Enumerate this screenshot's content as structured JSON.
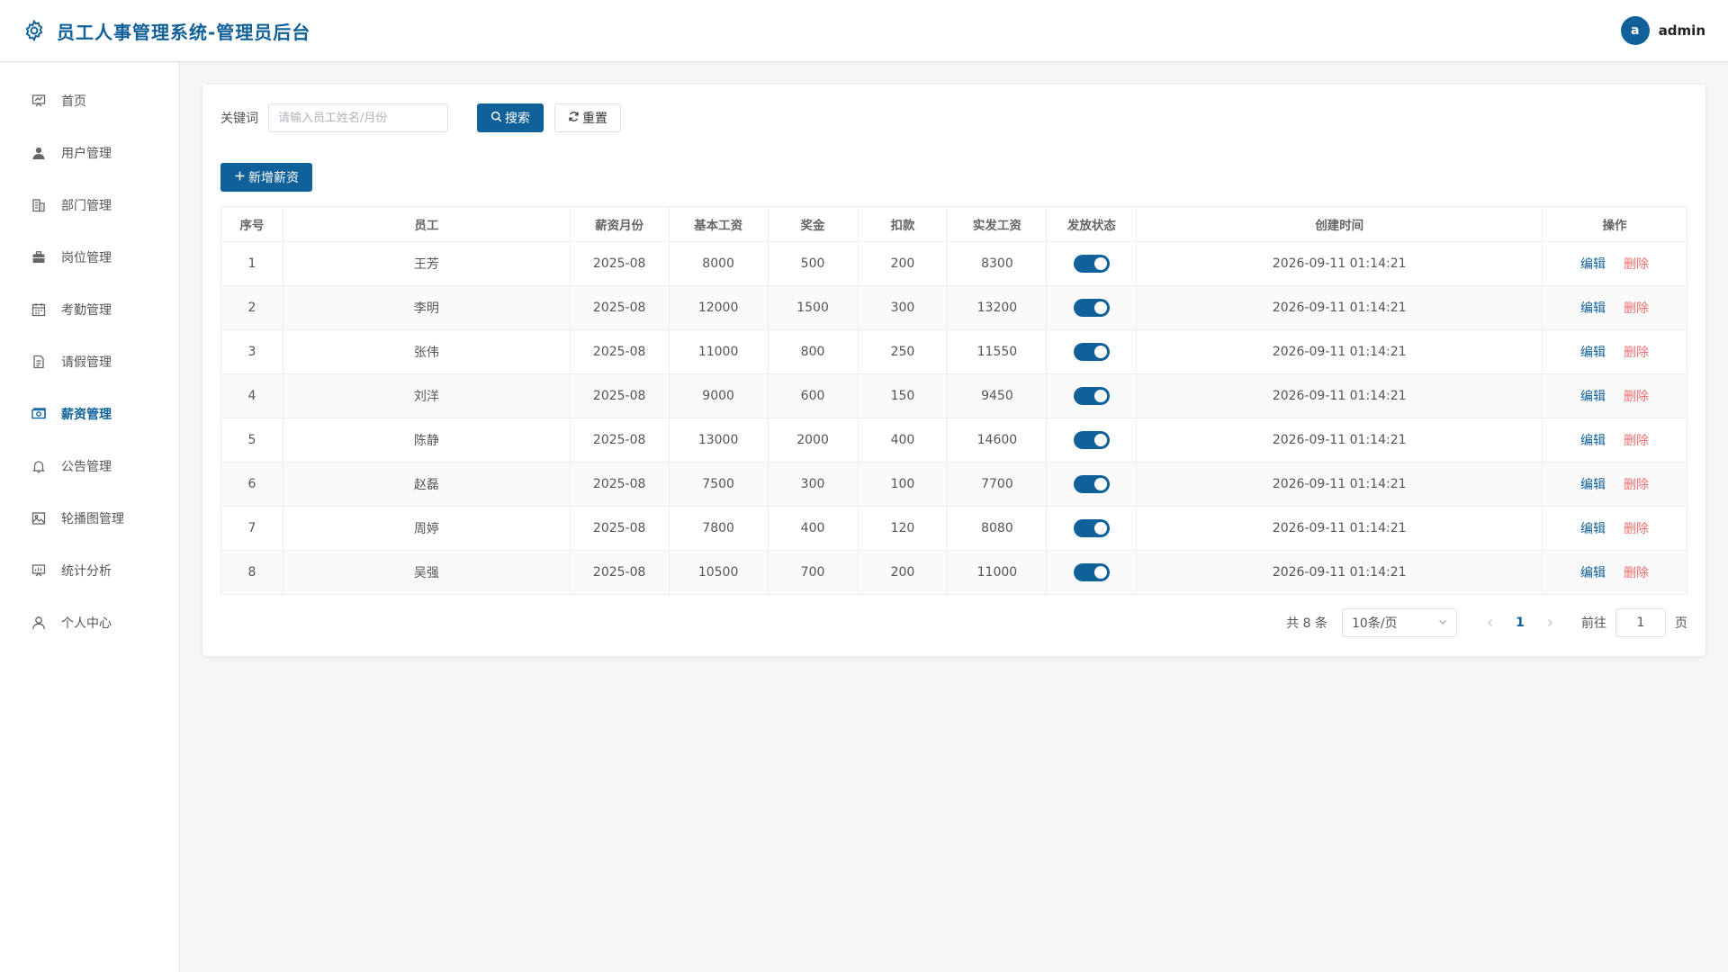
{
  "header": {
    "title": "员工人事管理系统-管理员后台",
    "avatar_letter": "a",
    "username": "admin"
  },
  "sidebar": {
    "items": [
      {
        "label": "首页",
        "icon": "presentation-board-icon"
      },
      {
        "label": "用户管理",
        "icon": "user-filled-icon"
      },
      {
        "label": "部门管理",
        "icon": "office-building-icon"
      },
      {
        "label": "岗位管理",
        "icon": "briefcase-icon"
      },
      {
        "label": "考勤管理",
        "icon": "calendar-icon"
      },
      {
        "label": "请假管理",
        "icon": "document-icon"
      },
      {
        "label": "薪资管理",
        "icon": "money-icon",
        "active": true
      },
      {
        "label": "公告管理",
        "icon": "bell-icon"
      },
      {
        "label": "轮播图管理",
        "icon": "picture-icon"
      },
      {
        "label": "统计分析",
        "icon": "data-board-icon"
      },
      {
        "label": "个人中心",
        "icon": "user-outline-icon"
      }
    ]
  },
  "search": {
    "label": "关键词",
    "placeholder": "请输入员工姓名/月份",
    "value": "",
    "search_button": "搜索",
    "reset_button": "重置"
  },
  "add_button": "新增薪资",
  "table": {
    "columns": [
      "序号",
      "员工",
      "薪资月份",
      "基本工资",
      "奖金",
      "扣款",
      "实发工资",
      "发放状态",
      "创建时间",
      "操作"
    ],
    "rows": [
      {
        "index": "1",
        "name": "王芳",
        "month": "2025-08",
        "base": "8000",
        "bonus": "500",
        "deduction": "200",
        "net": "8300",
        "status": true,
        "created": "2026-09-11 01:14:21"
      },
      {
        "index": "2",
        "name": "李明",
        "month": "2025-08",
        "base": "12000",
        "bonus": "1500",
        "deduction": "300",
        "net": "13200",
        "status": true,
        "created": "2026-09-11 01:14:21"
      },
      {
        "index": "3",
        "name": "张伟",
        "month": "2025-08",
        "base": "11000",
        "bonus": "800",
        "deduction": "250",
        "net": "11550",
        "status": true,
        "created": "2026-09-11 01:14:21"
      },
      {
        "index": "4",
        "name": "刘洋",
        "month": "2025-08",
        "base": "9000",
        "bonus": "600",
        "deduction": "150",
        "net": "9450",
        "status": true,
        "created": "2026-09-11 01:14:21"
      },
      {
        "index": "5",
        "name": "陈静",
        "month": "2025-08",
        "base": "13000",
        "bonus": "2000",
        "deduction": "400",
        "net": "14600",
        "status": true,
        "created": "2026-09-11 01:14:21"
      },
      {
        "index": "6",
        "name": "赵磊",
        "month": "2025-08",
        "base": "7500",
        "bonus": "300",
        "deduction": "100",
        "net": "7700",
        "status": true,
        "created": "2026-09-11 01:14:21"
      },
      {
        "index": "7",
        "name": "周婷",
        "month": "2025-08",
        "base": "7800",
        "bonus": "400",
        "deduction": "120",
        "net": "8080",
        "status": true,
        "created": "2026-09-11 01:14:21"
      },
      {
        "index": "8",
        "name": "吴强",
        "month": "2025-08",
        "base": "10500",
        "bonus": "700",
        "deduction": "200",
        "net": "11000",
        "status": true,
        "created": "2026-09-11 01:14:21"
      }
    ],
    "edit_label": "编辑",
    "delete_label": "删除"
  },
  "pagination": {
    "total_text": "共 8 条",
    "page_size": "10条/页",
    "current_page": "1",
    "goto_label": "前往",
    "goto_value": "1",
    "page_suffix": "页"
  },
  "colors": {
    "primary": "#10609a",
    "danger": "#f56c6c"
  }
}
